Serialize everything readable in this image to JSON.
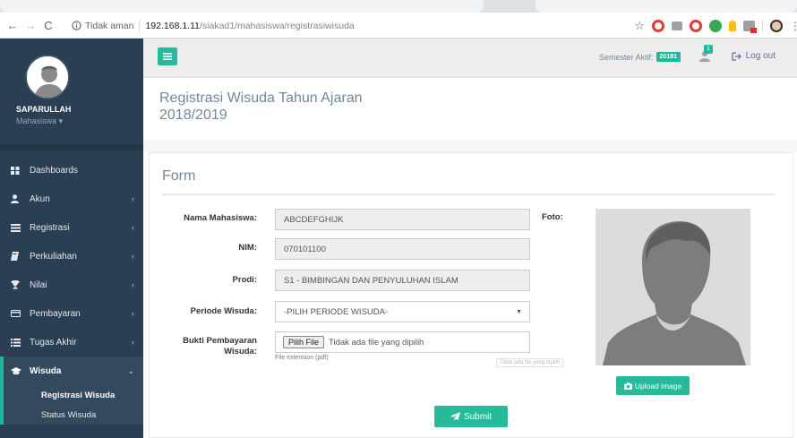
{
  "browser": {
    "security_label": "Tidak aman",
    "url_host": "192.168.1.11",
    "url_path": "/siakad1/mahasiswa/registrasiwisuda"
  },
  "sidebar": {
    "user_name": "SAPARULLAH",
    "user_role": "Mahasiswa ▾",
    "items": [
      {
        "label": "Dashboards",
        "icon": "dashboard-icon"
      },
      {
        "label": "Akun",
        "icon": "user-icon"
      },
      {
        "label": "Registrasi",
        "icon": "list-icon"
      },
      {
        "label": "Perkuliahan",
        "icon": "book-icon"
      },
      {
        "label": "Nilai",
        "icon": "trophy-icon"
      },
      {
        "label": "Pembayaran",
        "icon": "card-icon"
      },
      {
        "label": "Tugas Akhir",
        "icon": "list-icon"
      },
      {
        "label": "Wisuda",
        "icon": "graduation-cap-icon"
      }
    ],
    "submenu": [
      "Registrasi Wisuda",
      "Status Wisuda"
    ]
  },
  "topnav": {
    "semester_label": "Semester Aktif:",
    "semester_value": "20181",
    "notification_count": "1",
    "logout_label": "Log out"
  },
  "page": {
    "title": "Registrasi Wisuda Tahun Ajaran 2018/2019"
  },
  "form": {
    "title": "Form",
    "nama_label": "Nama Mahasiswa:",
    "nama_value": "ABCDEFGHIJK",
    "nim_label": "NIM:",
    "nim_value": "070101100",
    "prodi_label": "Prodi:",
    "prodi_value": "S1 - BIMBINGAN DAN PENYULUHAN ISLAM",
    "periode_label": "Periode Wisuda:",
    "periode_value": "-PILIH PERIODE WISUDA-",
    "bukti_label_1": "Bukti Pembayaran",
    "bukti_label_2": "Wisuda:",
    "file_button": "Pilih File",
    "file_status": "Tidak ada file yang dipilih",
    "file_hint": "File extension (pdf)",
    "tooltip": "Tidak ada file yang dipilih",
    "foto_label": "Foto:",
    "upload_label": "Upload image",
    "submit_label": "Submit"
  },
  "colors": {
    "accent": "#26b99a",
    "sidebar_bg": "#2a3f54"
  }
}
